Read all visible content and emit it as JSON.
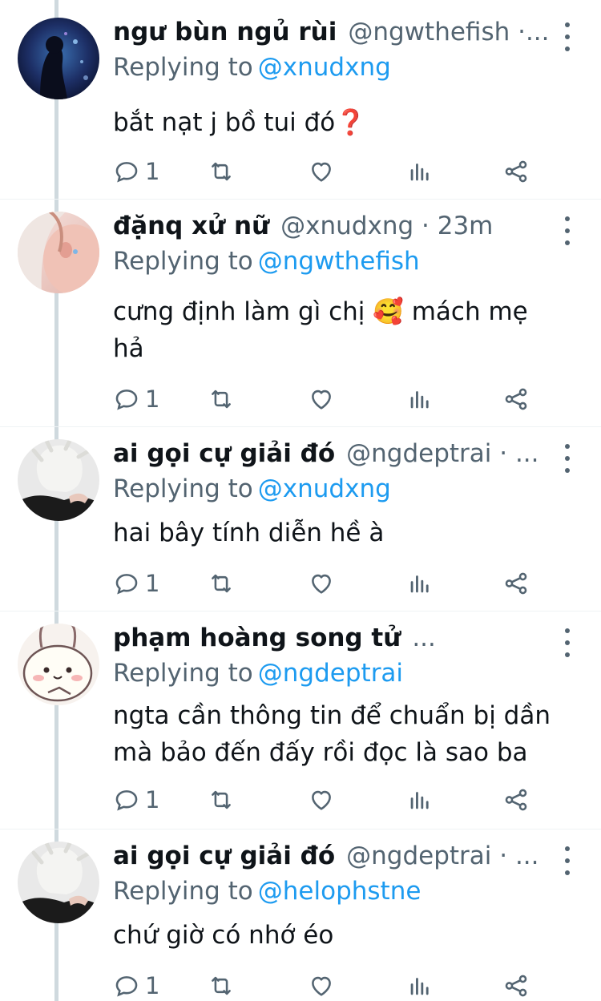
{
  "tweets": [
    {
      "display_name": "ngư bùn ngủ rùi",
      "handle_time": "@ngwthefish ·...",
      "replying_label": "Replying to",
      "replying_to": "@xnudxng",
      "text": "bắt nạt j bồ tui đó❓",
      "reply_count": "1",
      "avatar": "aquarium-photo-avatar"
    },
    {
      "display_name": "đặnq xử nữ",
      "handle_time": "@xnudxng · 23m",
      "replying_label": "Replying to",
      "replying_to": "@ngwthefish",
      "text": "cưng định làm gì chị 🥰  mách mẹ hả",
      "reply_count": "1",
      "avatar": "selfie-photo-avatar"
    },
    {
      "display_name": "ai gọi cự giải đó",
      "handle_time": "@ngdeptrai · ...",
      "replying_label": "Replying to",
      "replying_to": "@xnudxng",
      "text": "hai bây tính diễn hề à",
      "reply_count": "1",
      "avatar": "white-hair-character-avatar"
    },
    {
      "display_name": "phạm hoàng song tử",
      "handle_time": "...",
      "replying_label": "Replying to",
      "replying_to": "@ngdeptrai",
      "text": "ngta cần thông tin để chuẩn bị dần mà bảo đến đấy rồi đọc là sao ba",
      "reply_count": "1",
      "avatar": "cartoon-bunny-avatar"
    },
    {
      "display_name": "ai gọi cự giải đó",
      "handle_time": "@ngdeptrai · ...",
      "replying_label": "Replying to",
      "replying_to": "@helophstne",
      "text": "chứ giờ có nhớ éo",
      "reply_count": "1",
      "avatar": "white-hair-character-avatar"
    }
  ],
  "icons": {
    "reply": "reply-icon",
    "retweet": "retweet-icon",
    "like": "heart-icon",
    "views": "analytics-icon",
    "share": "share-icon",
    "more": "more-options-icon"
  },
  "colors": {
    "text": "#0f1419",
    "secondary": "#536471",
    "accent": "#1d9bf0",
    "thread_line": "#cfd9de"
  }
}
